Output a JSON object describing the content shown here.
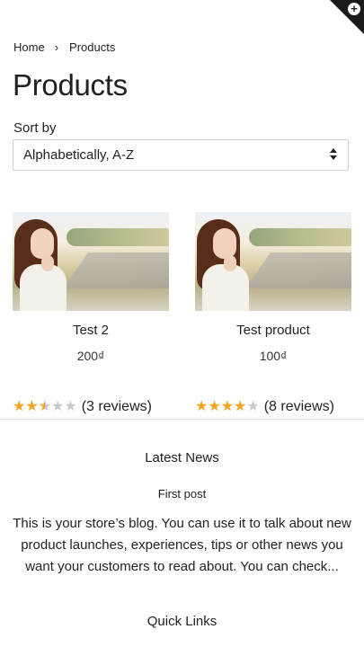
{
  "breadcrumb": {
    "home": "Home",
    "separator": "›",
    "current": "Products"
  },
  "page": {
    "title": "Products"
  },
  "sort": {
    "label": "Sort by",
    "selected": "Alphabetically, A-Z"
  },
  "products": [
    {
      "name": "Test 2",
      "price": "200₫",
      "rating": 2.5,
      "reviews": "(3 reviews)"
    },
    {
      "name": "Test product",
      "price": "100₫",
      "rating": 4,
      "reviews": "(8 reviews)"
    }
  ],
  "news": {
    "heading": "Latest News",
    "post_title": "First post",
    "excerpt": "This is your store’s blog. You can use it to talk about new product launches, experiences, tips or other news you want your customers to read about. You can check..."
  },
  "footer": {
    "quick_links_heading": "Quick Links"
  },
  "colors": {
    "star": "#f5a623",
    "star_empty": "#c9c9c9",
    "corner": "#1b1b1b"
  },
  "icons": {
    "corner": "plus-circle-icon",
    "sort": "sort-arrows-icon",
    "star": "star-icon"
  }
}
